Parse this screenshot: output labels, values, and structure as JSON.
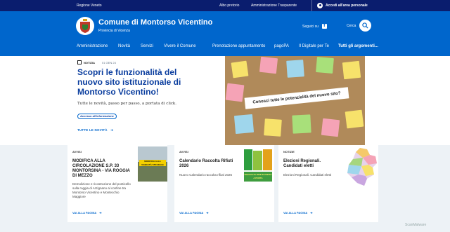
{
  "topbar": {
    "region": "Regione Veneto",
    "albo": "Albo pretorio",
    "amministrazione": "Amministrazione Trasparente",
    "login": "Accedi all'area personale"
  },
  "header": {
    "title": "Comune di Montorso Vicentino",
    "subtitle": "Provincia di Vicenza",
    "social_label": "Seguici su",
    "search_label": "Cerca"
  },
  "nav": {
    "items": [
      "Amministrazione",
      "Novità",
      "Servizi",
      "Vivere il Comune"
    ],
    "secondary": [
      "Prenotazione appuntamento",
      "pagoPA",
      "Il Digitale per Te",
      "Tutti gli argomenti..."
    ]
  },
  "hero": {
    "badge": "NOTIZIA",
    "date": "01 GEN 24",
    "title": "Scopri le funzionalità del nuovo sito istituzionale di Montorso Vicentino!",
    "description": "Tutte le novità, passo per passo, a portata di click.",
    "tag": "Accesso all'informazione",
    "all_news": "TUTTE LE NOVITÀ",
    "image_text": "Conosci tutte le potenzialità del nuovo sito?"
  },
  "cards": [
    {
      "category": "AVVISI",
      "title": "MODIFICA ALLA CIRCOLAZIONE S.P. 33 MONTORSINA - VIA ROGGIA DI MEZZO",
      "description": "Demolizione e ricostruzione del ponticello sulla roggia di Arzignano al confine tra Montorso Vicentino e Montecchio Maggiore",
      "more": "VAI ALLA PAGINA",
      "thumb_text": "MODIFICA ALLA VIABILITÀ STRADALE"
    },
    {
      "category": "AVVISI",
      "title": "Calendario Raccolta Rifiuti 2026",
      "description": "Nuovo Calendario raccolta rifiuti 2026",
      "more": "VAI ALLA PAGINA",
      "thumb_text": "RACCOLTA RIFIUTI PORTA A PORTA"
    },
    {
      "category": "NOTIZIE",
      "title": "Elezioni Regionali. Candidati eletti",
      "description": "Elezioni Regionali. Candidati eletti",
      "more": "VAI ALLA PAGINA"
    }
  ],
  "watermark": "ScanMalware"
}
